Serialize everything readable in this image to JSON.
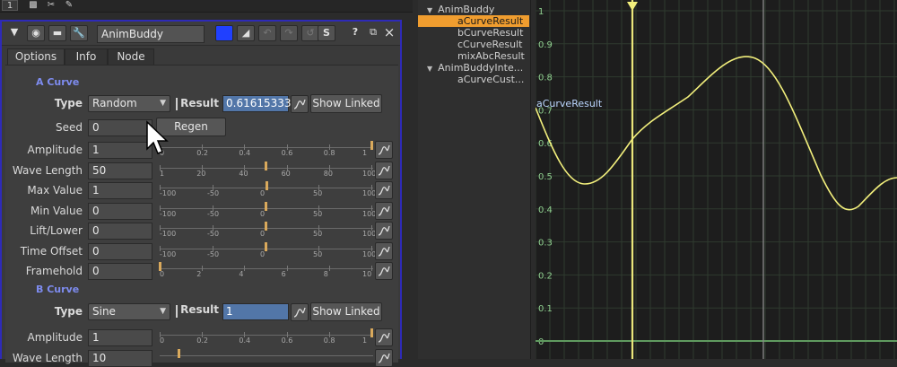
{
  "topbar": {
    "frame": "1",
    "icons": [
      "lock-icon",
      "scissors-icon",
      "pencil-icon"
    ]
  },
  "node": {
    "name": "AnimBuddy",
    "title_icons": [
      "collapse-arrow-icon",
      "circle-icon",
      "node-icon",
      "wrench-icon"
    ],
    "right_buttons": {
      "help": "?",
      "float": "⧉",
      "close": "×"
    }
  },
  "tabs": [
    {
      "label": "Options",
      "active": true
    },
    {
      "label": "Info",
      "active": false
    },
    {
      "label": "Node",
      "active": false
    }
  ],
  "a_curve": {
    "section": "A Curve",
    "type_label": "Type",
    "type_value": "Random",
    "result_label": "Result",
    "result_value": "0.61615333",
    "show_linked": "Show Linked",
    "seed_label": "Seed",
    "seed_value": "0",
    "regen": "Regen",
    "params": [
      {
        "label": "Amplitude",
        "value": "1",
        "ticks": [
          "0",
          "0.2",
          "0.4",
          "0.6",
          "0.8",
          "1"
        ],
        "pos": 1.0
      },
      {
        "label": "Wave Length",
        "value": "50",
        "ticks": [
          "1",
          "20",
          "40",
          "60",
          "80",
          "100"
        ],
        "pos": 0.5
      },
      {
        "label": "Max Value",
        "value": "1",
        "ticks": [
          "-100",
          "-50",
          "0",
          "50",
          "100"
        ],
        "pos": 0.505
      },
      {
        "label": "Min Value",
        "value": "0",
        "ticks": [
          "-100",
          "-50",
          "0",
          "50",
          "100"
        ],
        "pos": 0.5
      },
      {
        "label": "Lift/Lower",
        "value": "0",
        "ticks": [
          "-100",
          "-50",
          "0",
          "50",
          "100"
        ],
        "pos": 0.5
      },
      {
        "label": "Time Offset",
        "value": "0",
        "ticks": [
          "-100",
          "-50",
          "0",
          "50",
          "100"
        ],
        "pos": 0.5
      },
      {
        "label": "Framehold",
        "value": "0",
        "ticks": [
          "0",
          "2",
          "4",
          "6",
          "8",
          "10"
        ],
        "pos": 0.0
      }
    ]
  },
  "b_curve": {
    "section": "B Curve",
    "type_label": "Type",
    "type_value": "Sine",
    "result_label": "Result",
    "result_value": "1",
    "show_linked": "Show Linked",
    "params": [
      {
        "label": "Amplitude",
        "value": "1",
        "ticks": [
          "0",
          "0.2",
          "0.4",
          "0.6",
          "0.8",
          "1"
        ],
        "pos": 1.0
      },
      {
        "label": "Wave Length",
        "value": "10",
        "ticks": [],
        "pos": 0.09
      }
    ]
  },
  "tree": {
    "items": [
      {
        "label": "AnimBuddy",
        "depth": 0,
        "expanded": true,
        "selected": false
      },
      {
        "label": "aCurveResult",
        "depth": 1,
        "selected": true
      },
      {
        "label": "bCurveResult",
        "depth": 1,
        "selected": false
      },
      {
        "label": "cCurveResult",
        "depth": 1,
        "selected": false
      },
      {
        "label": "mixAbcResult",
        "depth": 1,
        "selected": false
      },
      {
        "label": "AnimBuddyInte...",
        "depth": 0,
        "expanded": true,
        "selected": false
      },
      {
        "label": "aCurveCust...",
        "depth": 1,
        "selected": false
      }
    ]
  },
  "curve_editor": {
    "curve_label": "aCurveResult",
    "y_ticks": [
      "1",
      "0.9",
      "0.8",
      "0.7",
      "0.6",
      "0.5",
      "0.4",
      "0.3",
      "0.2",
      "0.1",
      "0"
    ],
    "colors": {
      "curve": "#f2ef7c",
      "grid": "#2f3a2f",
      "axis": "#5f9a5f",
      "label": "#8fcf8f"
    }
  },
  "colors": {
    "accent": "#2e2ab8",
    "section": "#7e8cf0",
    "selected": "#f09d2f",
    "result_bg": "#5276a8"
  }
}
